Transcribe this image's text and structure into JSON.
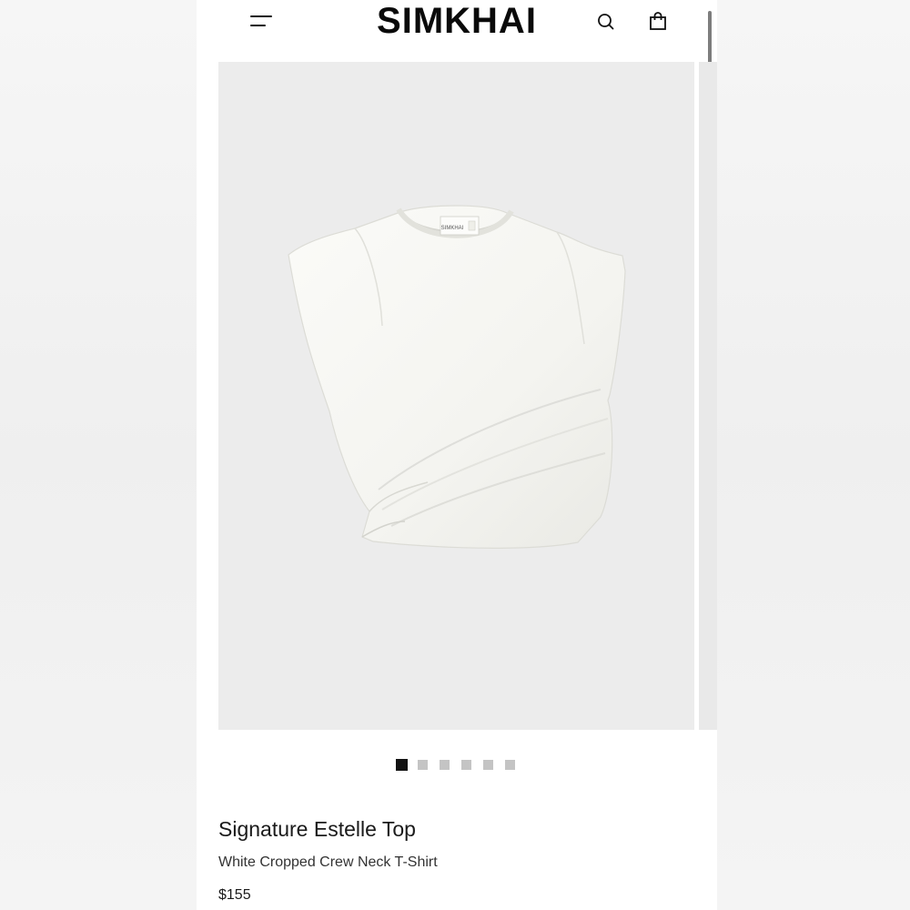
{
  "brand": {
    "logo_text": "SIMKHAI"
  },
  "header": {
    "menu_icon": "hamburger-menu-icon",
    "search_icon": "search-icon",
    "cart_icon": "shopping-bag-icon"
  },
  "gallery": {
    "image_subject": "white cropped draped t-shirt",
    "label_text": "SIMKHAI",
    "slide_count": 6,
    "active_slide": 1
  },
  "product": {
    "title": "Signature Estelle Top",
    "subtitle": "White Cropped Crew Neck T-Shirt",
    "price": "$155"
  },
  "colors": {
    "background": "#ffffff",
    "photo_background": "#ececec",
    "dot_active": "#121212",
    "dot_inactive": "#c4c4c4"
  }
}
